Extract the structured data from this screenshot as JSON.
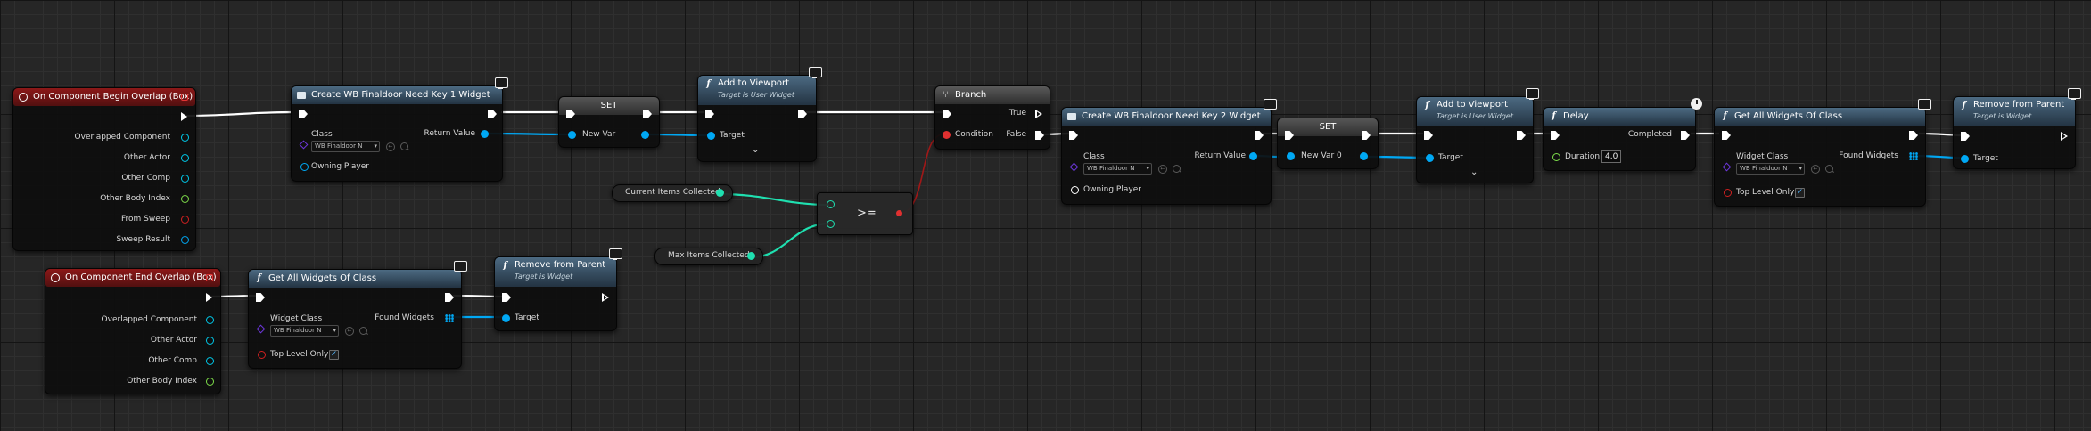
{
  "nodes": {
    "begin_overlap": {
      "title": "On Component Begin Overlap (Box)",
      "outputs": [
        "Overlapped Component",
        "Other Actor",
        "Other Comp",
        "Other Body Index",
        "From Sweep",
        "Sweep Result"
      ]
    },
    "end_overlap": {
      "title": "On Component End Overlap (Box)",
      "outputs": [
        "Overlapped Component",
        "Other Actor",
        "Other Comp",
        "Other Body Index"
      ]
    },
    "create_key1": {
      "title": "Create WB Finaldoor Need Key 1 Widget",
      "class_label": "Class",
      "class_value": "WB Finaldoor N",
      "owning_player": "Owning Player",
      "return_value": "Return Value"
    },
    "set1": {
      "title": "SET",
      "input": "New Var"
    },
    "add_viewport1": {
      "title": "Add to Viewport",
      "subtitle": "Target is User Widget",
      "target": "Target"
    },
    "branch": {
      "title": "Branch",
      "condition": "Condition",
      "true_label": "True",
      "false_label": "False"
    },
    "current_items": {
      "label": "Current Items Collected"
    },
    "max_items": {
      "label": "Max Items Collected"
    },
    "compare": {
      "op": ">="
    },
    "create_key2": {
      "title": "Create WB Finaldoor Need Key 2 Widget",
      "class_label": "Class",
      "class_value": "WB Finaldoor N",
      "owning_player": "Owning Player",
      "return_value": "Return Value"
    },
    "set2": {
      "title": "SET",
      "input": "New Var 0"
    },
    "add_viewport2": {
      "title": "Add to Viewport",
      "subtitle": "Target is User Widget",
      "target": "Target"
    },
    "delay": {
      "title": "Delay",
      "completed": "Completed",
      "duration_label": "Duration",
      "duration_value": "4.0"
    },
    "get_widgets1": {
      "title": "Get All Widgets Of Class",
      "widget_class": "Widget Class",
      "class_value": "WB Finaldoor N",
      "found": "Found Widgets",
      "top_level": "Top Level Only",
      "top_level_checked": "✓"
    },
    "remove1": {
      "title": "Remove from Parent",
      "subtitle": "Target is Widget",
      "target": "Target"
    },
    "get_widgets2": {
      "title": "Get All Widgets Of Class",
      "widget_class": "Widget Class",
      "class_value": "WB Finaldoor N",
      "found": "Found Widgets",
      "top_level": "Top Level Only",
      "top_level_checked": "✓"
    },
    "remove2": {
      "title": "Remove from Parent",
      "subtitle": "Target is Widget",
      "target": "Target"
    }
  },
  "colors": {
    "event_header": "#8c1818",
    "function_header": "#4c6a82",
    "exec_wire": "#ffffff",
    "object_wire": "#00a8f4",
    "int_wire": "#1fe0b0",
    "bool_wire": "#a01818",
    "graph_background": "#262626"
  },
  "icons": {
    "event": "event-diamond-icon",
    "function": "function-f-icon",
    "create_widget": "widget-icon",
    "branch": "branch-icon",
    "client_only": "monitor-icon",
    "latent": "clock-icon"
  }
}
